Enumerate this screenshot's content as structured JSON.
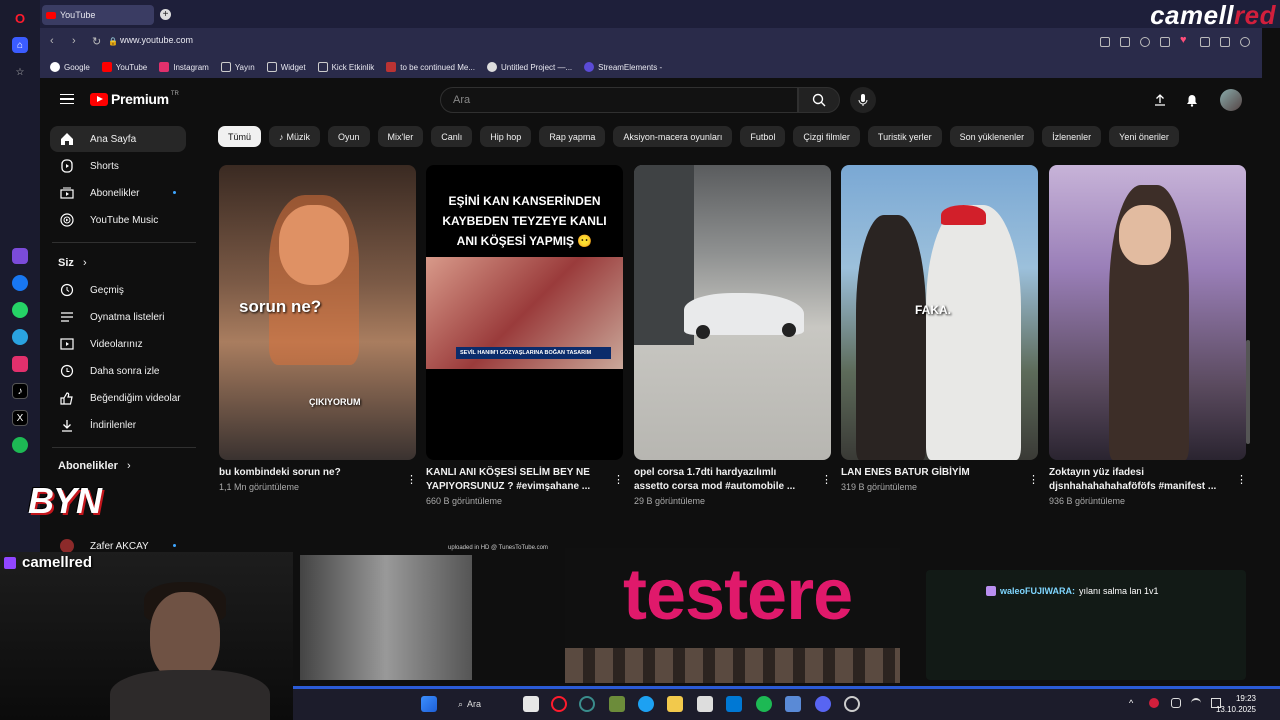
{
  "browser": {
    "tab_title": "YouTube",
    "url": "www.youtube.com",
    "bookmarks": [
      "Google",
      "YouTube",
      "Instagram",
      "Yayın",
      "Widget",
      "Kick Etkinlik",
      "to be continued Me...",
      "Untitled Project —...",
      "StreamElements -"
    ]
  },
  "overlay": {
    "brand_white": "camell",
    "brand_red": "red",
    "handle": "camellred",
    "byn": "BYN",
    "uploaded": "uploaded in HD @ TunesToTube.com",
    "testere": "testere",
    "chat_user": "waleoFUJIWARA:",
    "chat_msg": "yılanı salma lan 1v1"
  },
  "youtube": {
    "logo": "Premium",
    "logo_sup": "TR",
    "search_placeholder": "Ara",
    "sidebar": {
      "main": [
        "Ana Sayfa",
        "Shorts",
        "Abonelikler",
        "YouTube Music"
      ],
      "you_heading": "Siz",
      "you": [
        "Geçmiş",
        "Oynatma listeleri",
        "Videolarınız",
        "Daha sonra izle",
        "Beğendiğim videolar",
        "İndirilenler"
      ],
      "subs_heading": "Abonelikler",
      "subs": [
        "Zafer AKCAY"
      ]
    },
    "chips": [
      "Tümü",
      "Müzik",
      "Oyun",
      "Mix'ler",
      "Canlı",
      "Hip hop",
      "Rap yapma",
      "Aksiyon-macera oyunları",
      "Futbol",
      "Çizgi filmler",
      "Turistik yerler",
      "Son yüklenenler",
      "İzlenenler",
      "Yeni öneriler"
    ],
    "videos": [
      {
        "title": "bu kombindeki sorun ne?",
        "views": "1,1 Mn görüntüleme",
        "overlay": "sorun ne?",
        "overlay2": "ÇIKIYORUM"
      },
      {
        "title": "KANLI ANI KÖŞESİ SELİM BEY NE YAPIYORSUNUZ ? #evimşahane ...",
        "views": "660 B görüntüleme",
        "overlay": "EŞİNİ KAN KANSERİNDEN KAYBEDEN TEYZEYE KANLI ANI KÖŞESİ YAPMIŞ 😶",
        "overlay2": "SEVİL HANIM'I GÖZYAŞLARINA BOĞAN TASARIM"
      },
      {
        "title": "opel corsa 1.7dti hardyazılımlı assetto corsa mod #automobile ...",
        "views": "29 B görüntüleme"
      },
      {
        "title": "LAN ENES BATUR GİBİYİM",
        "views": "319 B görüntüleme",
        "overlay": "FAKA."
      },
      {
        "title": "Zoktayın yüz ifadesi djsnhahahahahaföföfs #manifest ...",
        "views": "936 B görüntüleme"
      }
    ]
  },
  "taskbar": {
    "search": "Ara",
    "time": "19:23",
    "date": "13.10.2025"
  },
  "colors": {
    "accent": "#ff0000",
    "brand_red": "#d21f3c",
    "testere": "#e0196b",
    "twitch": "#9146ff"
  }
}
